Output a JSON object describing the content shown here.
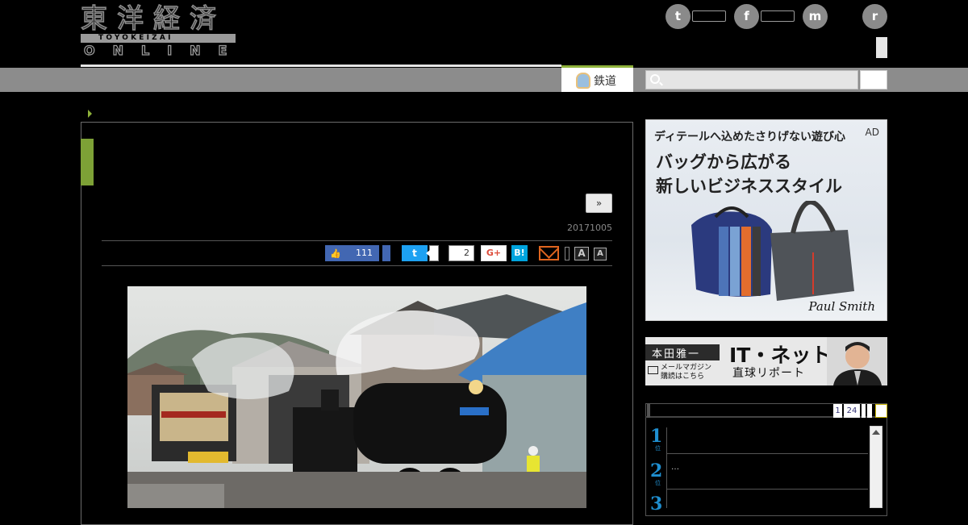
{
  "header": {
    "logo_kanji": "東洋経済",
    "logo_sub": "TOYOKEIZAI",
    "logo_online": "ONLINE",
    "social": [
      {
        "name": "twitter",
        "glyph": "t"
      },
      {
        "name": "facebook",
        "glyph": "f"
      },
      {
        "name": "messenger",
        "glyph": "m"
      },
      {
        "name": "rss",
        "glyph": "r"
      }
    ]
  },
  "nav": {
    "active_tab_label": "鉄道",
    "search": {
      "value": "",
      "placeholder": ""
    }
  },
  "article": {
    "next_label": "»",
    "date": "20171005",
    "share": {
      "like_count": "111",
      "like_glyph": "👍",
      "twitter_glyph": "t",
      "hatena_count": "2",
      "gplus_label": "G+",
      "hatena_label": "B!",
      "font_large": "A",
      "font_small": "A"
    }
  },
  "sidebar": {
    "ad": {
      "tag": "AD",
      "subcopy": "ディテールへ込めたさりげない遊び心",
      "headline_1": "バッグから広がる",
      "headline_2": "新しいビジネススタイル",
      "brand": "Paul Smith"
    },
    "banner": {
      "name": "本田雅一",
      "title": "IT・ネット",
      "subtitle": "直球リポート",
      "mag_line1": "メールマガジン",
      "mag_line2": "購読はこちら"
    },
    "ranking": {
      "pages": [
        "1",
        "24"
      ],
      "items": [
        {
          "rank": "1",
          "suffix": "位",
          "text": ""
        },
        {
          "rank": "2",
          "suffix": "位",
          "text": "…"
        },
        {
          "rank": "3",
          "suffix": "",
          "text": ""
        }
      ]
    }
  },
  "colors": {
    "accent_green": "#8eb13a",
    "facebook_blue": "#4267b2",
    "twitter_blue": "#1da1f2",
    "rank_blue": "#1f8fd0",
    "mail_orange": "#e0651f"
  }
}
